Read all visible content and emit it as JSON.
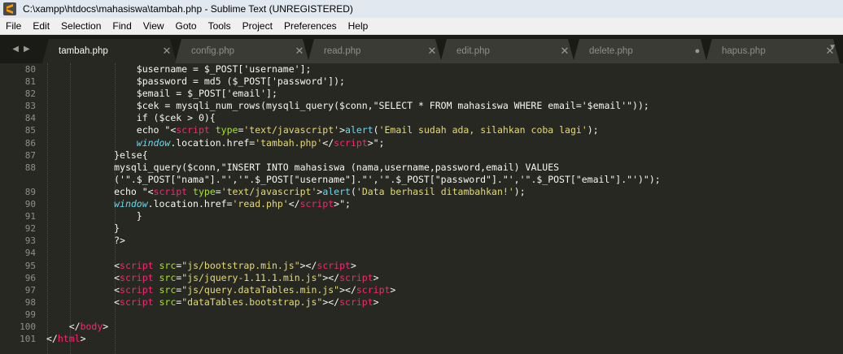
{
  "titlebar": {
    "title": "C:\\xampp\\htdocs\\mahasiswa\\tambah.php - Sublime Text (UNREGISTERED)"
  },
  "menu": [
    "File",
    "Edit",
    "Selection",
    "Find",
    "View",
    "Goto",
    "Tools",
    "Project",
    "Preferences",
    "Help"
  ],
  "tabs": [
    {
      "label": "tambah.php",
      "active": true,
      "close": "✕"
    },
    {
      "label": "config.php",
      "active": false,
      "close": "✕"
    },
    {
      "label": "read.php",
      "active": false,
      "close": "✕"
    },
    {
      "label": "edit.php",
      "active": false,
      "close": "✕"
    },
    {
      "label": "delete.php",
      "active": false,
      "close": "●"
    },
    {
      "label": "hapus.php",
      "active": false,
      "close": "✕"
    }
  ],
  "editor": {
    "gutter": [
      "80",
      "81",
      "82",
      "83",
      "84",
      "85",
      "86",
      "87",
      "88",
      "",
      "89",
      "90",
      "91",
      "92",
      "93",
      "94",
      "95",
      "96",
      "97",
      "98",
      "99",
      "100",
      "101"
    ],
    "colors": {
      "background": "#272822",
      "tag": "#f92672",
      "attr": "#a6e22e",
      "string": "#e6db74",
      "keyword": "#66d9ef"
    }
  }
}
